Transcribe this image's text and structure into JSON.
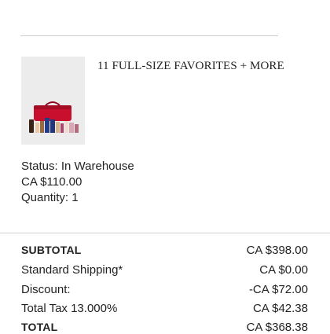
{
  "product": {
    "title": "11 FULL-SIZE FAVORITES + MORE",
    "status": "Status: In Warehouse",
    "price": "CA $110.00",
    "quantity": "Quantity: 1"
  },
  "summary": {
    "subtotal_label": "SUBTOTAL",
    "subtotal_value": "CA $398.00",
    "shipping_label": "Standard Shipping*",
    "shipping_value": "CA $0.00",
    "discount_label": "Discount:",
    "discount_value": "-CA $72.00",
    "tax_label": "Total Tax 13.000%",
    "tax_value": "CA $42.38",
    "total_label": "TOTAL",
    "total_value": "CA $368.38"
  },
  "colors": {
    "case_red": "#c8102e",
    "divider": "#cfcfcf",
    "thumb_bg": "#ececec"
  }
}
